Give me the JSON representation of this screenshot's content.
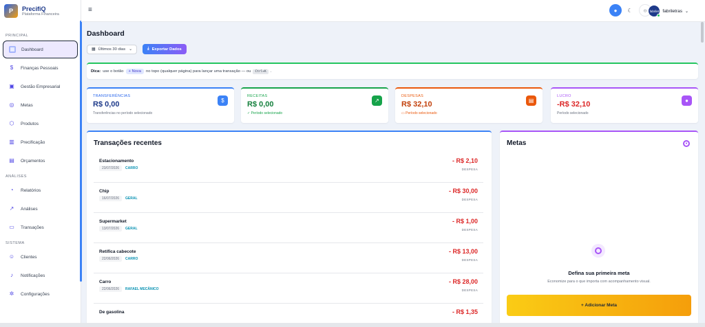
{
  "brand": {
    "name": "PrecifiQ",
    "subtitle": "Plataforma Financeira",
    "logo_text": "P"
  },
  "sidebar": {
    "sections": [
      {
        "title": "PRINCIPAL",
        "items": [
          {
            "label": "Dashboard",
            "icon": "dashboard-icon",
            "active": true
          },
          {
            "label": "Finanças Pessoais",
            "icon": "dollar-icon"
          },
          {
            "label": "Gestão Empresarial",
            "icon": "briefcase-icon"
          },
          {
            "label": "Metas",
            "icon": "target-icon"
          },
          {
            "label": "Produtos",
            "icon": "box-icon"
          },
          {
            "label": "Precificação",
            "icon": "calculator-icon"
          },
          {
            "label": "Orçamentos",
            "icon": "document-icon"
          }
        ]
      },
      {
        "title": "ANÁLISES",
        "items": [
          {
            "label": "Relatórios",
            "icon": "pie-chart-icon"
          },
          {
            "label": "Análises",
            "icon": "trend-icon"
          },
          {
            "label": "Transações",
            "icon": "card-icon"
          }
        ]
      },
      {
        "title": "SISTEMA",
        "items": [
          {
            "label": "Clientes",
            "icon": "users-icon"
          },
          {
            "label": "Notificações",
            "icon": "bell-icon"
          },
          {
            "label": "Configurações",
            "icon": "gear-icon"
          }
        ]
      }
    ]
  },
  "topbar": {
    "user_name": "fabriletras",
    "avatar_text": "fabrilet"
  },
  "page": {
    "title": "Dashboard",
    "period": "Últimos 30 dias",
    "export_label": "Exportar Dados",
    "tip": {
      "prefix": "Dica:",
      "text1": "use o botão",
      "chip": "+ Nova",
      "text2": "no topo (qualquer página) para lançar uma transação — ou",
      "kbd": "Ctrl+K",
      "end": "."
    }
  },
  "cards": [
    {
      "label": "TRANSFERÊNCIAS",
      "value": "R$ 0,00",
      "sub": "Transferências no período selecionado",
      "color": "#3b82f6",
      "icon": "dollar-icon",
      "glyph": "$"
    },
    {
      "label": "RECEITAS",
      "value": "R$ 0,00",
      "sub": "✓ Período selecionado",
      "color": "#16a34a",
      "icon": "trend-up-icon",
      "glyph": "↗"
    },
    {
      "label": "DESPESAS",
      "value": "R$ 32,10",
      "sub": "▭ Período selecionado",
      "color": "#ea580c",
      "icon": "wallet-icon",
      "glyph": "▤"
    },
    {
      "label": "LUCRO",
      "value": "-R$ 32,10",
      "sub": "Período selecionado",
      "color": "#a855f7",
      "icon": "piggy-icon",
      "glyph": "●"
    }
  ],
  "transactions": {
    "title": "Transações recentes",
    "items": [
      {
        "name": "Estacionamento",
        "date": "23/07/2026",
        "category": "CARRO",
        "amount": "- R$ 2,10",
        "type": "DESPESA"
      },
      {
        "name": "Chip",
        "date": "16/07/2026",
        "category": "GERAL",
        "amount": "- R$ 30,00",
        "type": "DESPESA"
      },
      {
        "name": "Supermarket",
        "date": "13/07/2026",
        "category": "GERAL",
        "amount": "- R$ 1,00",
        "type": "DESPESA"
      },
      {
        "name": "Retífica cabecote",
        "date": "22/06/2026",
        "category": "CARRO",
        "amount": "- R$ 13,00",
        "type": "DESPESA"
      },
      {
        "name": "Carro",
        "date": "22/06/2026",
        "category": "RAFAEL MECÂNICO",
        "amount": "- R$ 28,00",
        "type": "DESPESA"
      },
      {
        "name": "De gasolina",
        "date": "",
        "category": "",
        "amount": "- R$ 1,35",
        "type": ""
      }
    ]
  },
  "goals": {
    "title": "Metas",
    "empty_title": "Defina sua primeira meta",
    "empty_sub": "Economize para o que importa com acompanhamento visual.",
    "add_label": "+ Adicionar Meta"
  },
  "colors": {
    "accent": "#3b82f6",
    "negative": "#dc2626",
    "goal_button": "#f59e0b"
  }
}
